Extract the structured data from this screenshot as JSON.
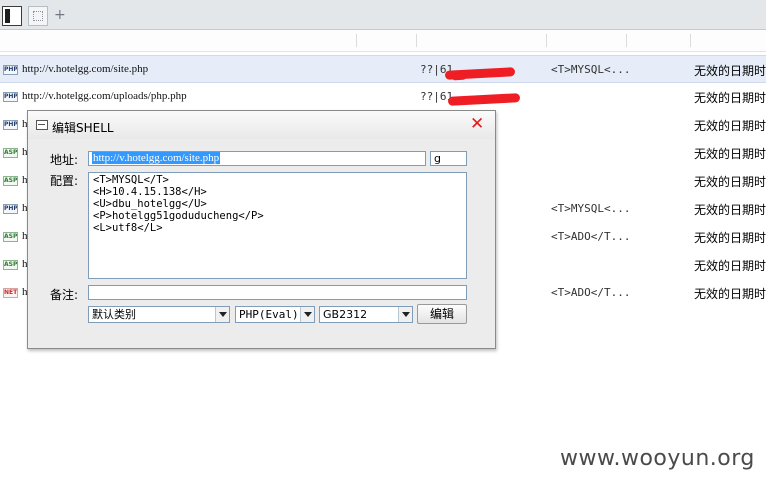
{
  "tabs": {
    "add_label": "+"
  },
  "rows": [
    {
      "type": "PHP",
      "url": "http://v.hotelgg.com/site.php",
      "ip": "??|61.",
      "config": "<T>MYSQL<...",
      "date": "无效的日期时"
    },
    {
      "type": "PHP",
      "url": "http://v.hotelgg.com/uploads/php.php",
      "ip": "??|61.",
      "config": "",
      "date": "无效的日期时"
    },
    {
      "type": "PHP",
      "url": "h",
      "ip": "",
      "config": "",
      "date": "无效的日期时"
    },
    {
      "type": "ASP",
      "url": "h",
      "ip": "",
      "config": "",
      "date": "无效的日期时"
    },
    {
      "type": "ASP",
      "url": "h",
      "ip": "",
      "config": "",
      "date": "无效的日期时"
    },
    {
      "type": "PHP",
      "url": "h",
      "ip": "",
      "config": "<T>MYSQL<...",
      "date": "无效的日期时"
    },
    {
      "type": "ASP",
      "url": "h",
      "ip": "",
      "config": "<T>ADO</T...",
      "date": "无效的日期时"
    },
    {
      "type": "ASP",
      "url": "h",
      "ip": "",
      "config": "",
      "date": "无效的日期时"
    },
    {
      "type": "NET",
      "url": "h",
      "ip": "",
      "config": "<T>ADO</T...",
      "date": "无效的日期时"
    }
  ],
  "dialog": {
    "title": "编辑SHELL",
    "close_glyph": "✕",
    "address_label": "地址:",
    "address_value": "http://v.hotelgg.com/site.php",
    "password_value": "g",
    "config_label": "配置:",
    "config_lines": [
      "<T>MYSQL</T>",
      "<H>10.4.15.138</H>",
      "<U>dbu_hotelgg</U>",
      "<P>hotelgg51goduducheng</P>",
      "<L>utf8</L>"
    ],
    "note_label": "备注:",
    "note_value": "",
    "category_select": "默认类别",
    "script_select": "PHP(Eval)",
    "encoding_select": "GB2312",
    "edit_button": "编辑"
  },
  "watermark": "www.wooyun.org",
  "colors": {
    "selection_row": "#e6edf8",
    "redaction": "#ef1d24",
    "close_icon": "#e01b1b",
    "text_selection": "#3399ff"
  }
}
